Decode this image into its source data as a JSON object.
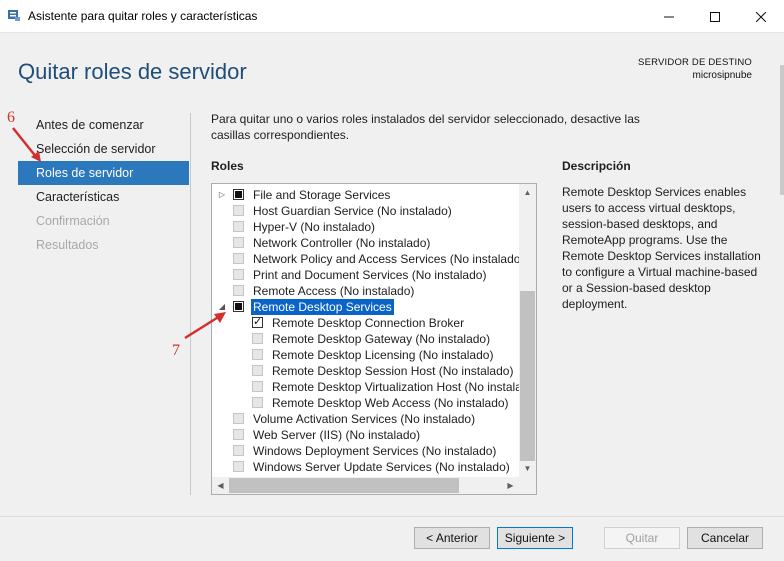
{
  "window": {
    "title": "Asistente para quitar roles y características",
    "controls": [
      "minimize",
      "maximize",
      "close"
    ]
  },
  "header": {
    "page_title": "Quitar roles de servidor",
    "dest_label": "SERVIDOR DE DESTINO",
    "dest_server": "microsipnube"
  },
  "nav": {
    "items": [
      {
        "label": "Antes de comenzar",
        "state": "normal"
      },
      {
        "label": "Selección de servidor",
        "state": "normal"
      },
      {
        "label": "Roles de servidor",
        "state": "active"
      },
      {
        "label": "Características",
        "state": "normal"
      },
      {
        "label": "Confirmación",
        "state": "disabled"
      },
      {
        "label": "Resultados",
        "state": "disabled"
      }
    ]
  },
  "main": {
    "intro": "Para quitar uno o varios roles instalados del servidor seleccionado, desactive las casillas correspondientes.",
    "roles_heading": "Roles",
    "description_heading": "Descripción",
    "description_text": "Remote Desktop Services enables users to access virtual desktops, session-based desktops, and RemoteApp programs. Use the Remote Desktop Services installation to configure a Virtual machine-based or a Session-based desktop deployment."
  },
  "roles": [
    {
      "label": "File and Storage Services",
      "state": "partial",
      "level": 0,
      "expander": "collapsed"
    },
    {
      "label": "Host Guardian Service (No instalado)",
      "state": "disabled",
      "level": 0
    },
    {
      "label": "Hyper-V (No instalado)",
      "state": "disabled",
      "level": 0
    },
    {
      "label": "Network Controller (No instalado)",
      "state": "disabled",
      "level": 0
    },
    {
      "label": "Network Policy and Access Services (No instalado)",
      "state": "disabled",
      "level": 0
    },
    {
      "label": "Print and Document Services (No instalado)",
      "state": "disabled",
      "level": 0
    },
    {
      "label": "Remote Access (No instalado)",
      "state": "disabled",
      "level": 0
    },
    {
      "label": "Remote Desktop Services",
      "state": "partial",
      "level": 0,
      "expander": "expanded",
      "selected": true
    },
    {
      "label": "Remote Desktop Connection Broker",
      "state": "checked",
      "level": 1
    },
    {
      "label": "Remote Desktop Gateway (No instalado)",
      "state": "disabled",
      "level": 1
    },
    {
      "label": "Remote Desktop Licensing (No instalado)",
      "state": "disabled",
      "level": 1
    },
    {
      "label": "Remote Desktop Session Host (No instalado)",
      "state": "disabled",
      "level": 1
    },
    {
      "label": "Remote Desktop Virtualization Host (No instalado)",
      "state": "disabled",
      "level": 1
    },
    {
      "label": "Remote Desktop Web Access (No instalado)",
      "state": "disabled",
      "level": 1
    },
    {
      "label": "Volume Activation Services (No instalado)",
      "state": "disabled",
      "level": 0
    },
    {
      "label": "Web Server (IIS) (No instalado)",
      "state": "disabled",
      "level": 0
    },
    {
      "label": "Windows Deployment Services (No instalado)",
      "state": "disabled",
      "level": 0
    },
    {
      "label": "Windows Server Update Services (No instalado)",
      "state": "disabled",
      "level": 0
    }
  ],
  "footer": {
    "back": "< Anterior",
    "next": "Siguiente >",
    "remove": "Quitar",
    "cancel": "Cancelar"
  },
  "annotations": {
    "step6": "6",
    "step7": "7",
    "color": "#d32f2f"
  },
  "colors": {
    "accent": "#2b78bc",
    "selection": "#0a64c8",
    "title": "#1f4e79"
  }
}
